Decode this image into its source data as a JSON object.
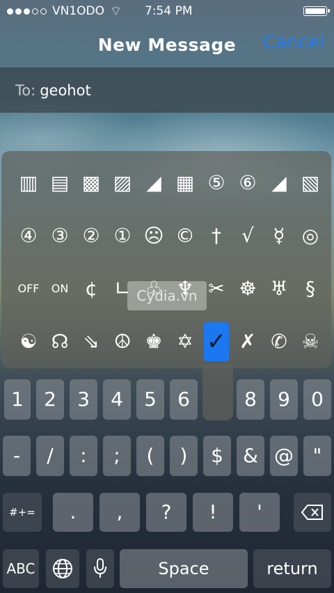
{
  "status": {
    "carrier": "VN1ODO",
    "time": "7:54 PM"
  },
  "nav": {
    "title": "New Message",
    "cancel": "Cancel"
  },
  "recipient": {
    "label": "To:",
    "value": "geohot"
  },
  "symbols": {
    "row1": [
      "▥",
      "▤",
      "▩",
      "▨",
      "◢",
      "▦",
      "⑤",
      "⑥",
      "◢",
      "▧"
    ],
    "row2": [
      "④",
      "③",
      "②",
      "①",
      "☹",
      "©",
      "†",
      "√",
      "☿",
      "◎"
    ],
    "row3": [
      "OFF",
      "ON",
      "¢",
      "∟",
      "♧",
      "♆",
      "✂",
      "☸",
      "♅",
      "§"
    ],
    "row4": [
      "☯",
      "☊",
      "⇘",
      "☮",
      "♚",
      "✡",
      "✓",
      "✗",
      "✆",
      "☠"
    ]
  },
  "watermark": "Cydia.vn",
  "keys": {
    "row1": [
      "1",
      "2",
      "3",
      "4",
      "5",
      "6",
      "8",
      "9",
      "0"
    ],
    "row2": [
      "-",
      "/",
      ":",
      ";",
      "(",
      ")",
      "$",
      "&",
      "@",
      "\""
    ],
    "row3": [
      ".",
      ",",
      "?",
      "!",
      "'"
    ],
    "more_label": "#+=",
    "abc_label": "ABC",
    "space_label": "Space",
    "return_label": "return"
  },
  "colors": {
    "accent": "#1f7cf0",
    "selected": "#1c78f0"
  }
}
